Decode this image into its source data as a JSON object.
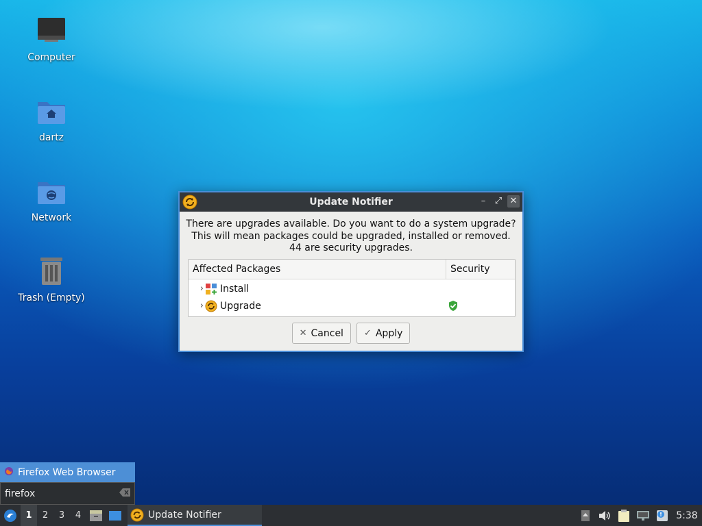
{
  "desktop": {
    "icons": [
      {
        "label": "Computer"
      },
      {
        "label": "dartz"
      },
      {
        "label": "Network"
      },
      {
        "label": "Trash (Empty)"
      }
    ]
  },
  "dialog": {
    "title": "Update Notifier",
    "message_lines": [
      "There are upgrades available. Do you want to do a system upgrade?",
      "This will mean packages could be upgraded, installed or removed.",
      "44 are security upgrades."
    ],
    "columns": [
      "Affected Packages",
      "Security"
    ],
    "rows": [
      {
        "label": "Install",
        "security": false
      },
      {
        "label": "Upgrade",
        "security": true
      }
    ],
    "buttons": {
      "cancel": "Cancel",
      "apply": "Apply"
    },
    "window_controls": [
      "minimize-icon",
      "maximize-icon",
      "close-icon"
    ]
  },
  "launcher": {
    "result_label": "Firefox Web Browser",
    "query": "firefox"
  },
  "taskbar": {
    "workspaces": [
      "1",
      "2",
      "3",
      "4"
    ],
    "active_workspace": "1",
    "task_title": "Update Notifier",
    "clock": "5:38"
  },
  "colors": {
    "accent": "#4a8ed8",
    "titlebar": "#33373b",
    "taskbar": "#2c2f33",
    "security_green": "#3aa53a"
  }
}
